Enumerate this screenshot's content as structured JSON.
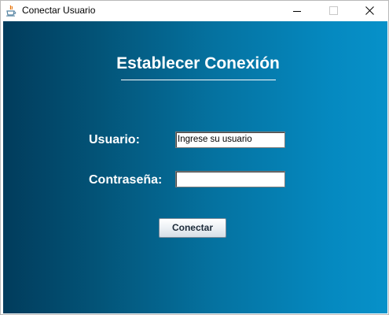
{
  "window": {
    "title": "Conectar Usuario",
    "icon": "java-cup-icon",
    "controls": [
      "minimize-icon",
      "maximize-icon",
      "close-icon"
    ]
  },
  "form": {
    "heading": "Establecer Conexión",
    "username_label": "Usuario:",
    "username_value": "Ingrese su usuario",
    "password_label": "Contraseña:",
    "password_value": "",
    "connect_label": "Conectar"
  },
  "colors": {
    "gradient_dark": "#013c5c",
    "gradient_light": "#0791c9",
    "label_text": "#ffffff"
  }
}
